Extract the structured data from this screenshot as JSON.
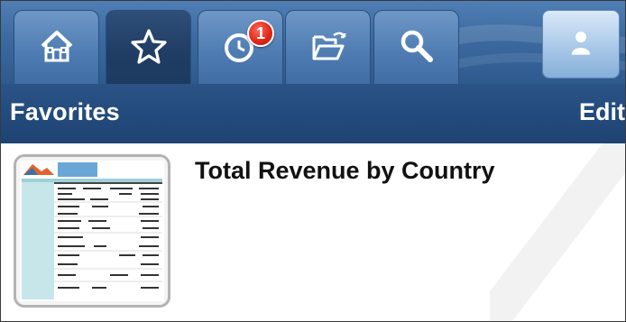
{
  "tabs": [
    {
      "name": "home",
      "icon": "home-icon",
      "active": false
    },
    {
      "name": "favorites",
      "icon": "star-icon",
      "active": true
    },
    {
      "name": "recent",
      "icon": "clock-icon",
      "active": false,
      "badge": "1"
    },
    {
      "name": "folders",
      "icon": "folder-open-icon",
      "active": false
    },
    {
      "name": "search",
      "icon": "search-icon",
      "active": false
    }
  ],
  "user_icon": "user-icon",
  "header": {
    "title": "Favorites",
    "edit_label": "Edit"
  },
  "favorites": [
    {
      "title": "Total Revenue by Country",
      "thumbnail_icon": "report-thumbnail"
    }
  ],
  "colors": {
    "tab_bar": "#3c6aa0",
    "title_bar": "#234b7d",
    "badge": "#e02a1a",
    "text_dark": "#111111"
  }
}
